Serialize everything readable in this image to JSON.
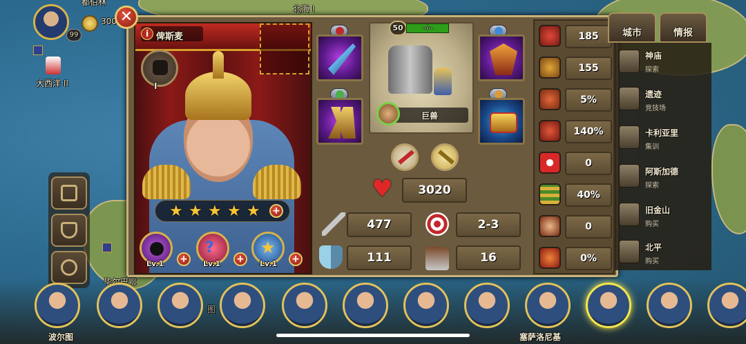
{
  "player": {
    "level": "99",
    "coins": "300"
  },
  "map": {
    "top_labels": [
      "都伯林",
      "北海 I"
    ],
    "left_labels": [
      "大西洋 II",
      "毕尔巴鄂"
    ],
    "misc_label": "图"
  },
  "close_label": "✕",
  "hero": {
    "name": "俾斯麦",
    "medal_rank": "I",
    "stars": 5,
    "skills": [
      {
        "level": "Lv.1"
      },
      {
        "level": "Lv.1"
      },
      {
        "level": "Lv.1"
      }
    ]
  },
  "troop": {
    "level": "50",
    "hp_text": "--/--",
    "name": "巨兽"
  },
  "stats": {
    "hp": "3020",
    "attack": "477",
    "range": "2-3",
    "defense": "111",
    "move": "16"
  },
  "right_stats": [
    "185",
    "155",
    "5%",
    "140%",
    "0",
    "40%",
    "0",
    "0%"
  ],
  "tabs": {
    "city": "城市",
    "intel": "情报"
  },
  "cities": [
    {
      "name": "神庙",
      "action": "探索"
    },
    {
      "name": "遗迹",
      "action": "竞技场"
    },
    {
      "name": "卡利亚里",
      "action": "集训"
    },
    {
      "name": "阿斯加德",
      "action": "探索"
    },
    {
      "name": "旧金山",
      "action": "购买"
    },
    {
      "name": "北平",
      "action": "购买"
    }
  ],
  "hero_bar": {
    "first_label": "波尔图",
    "last_label": "塞萨洛尼基"
  }
}
